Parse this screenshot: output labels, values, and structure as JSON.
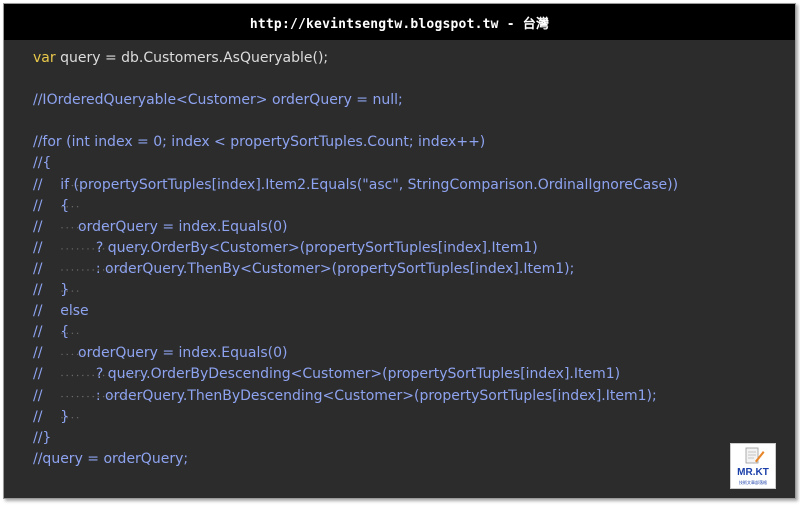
{
  "header": {
    "title": "http://kevintsengtw.blogspot.tw - 台灣"
  },
  "code": {
    "lines": [
      {
        "kw": "var",
        "rest": " query = db.Customers.AsQueryable();"
      },
      {
        "kw": "",
        "rest": ""
      },
      {
        "comment": "//IOrderedQueryable<Customer> orderQuery = null;"
      },
      {
        "kw": "",
        "rest": ""
      },
      {
        "comment": "//for (int index = 0; index < propertySortTuples.Count; index++)"
      },
      {
        "comment": "//{"
      },
      {
        "comment": "//    if (propertySortTuples[index].Item2.Equals(\"asc\", StringComparison.OrdinalIgnoreCase))"
      },
      {
        "comment": "//    {"
      },
      {
        "comment": "//        orderQuery = index.Equals(0)"
      },
      {
        "comment": "//            ? query.OrderBy<Customer>(propertySortTuples[index].Item1)"
      },
      {
        "comment": "//            : orderQuery.ThenBy<Customer>(propertySortTuples[index].Item1);"
      },
      {
        "comment": "//    }"
      },
      {
        "comment": "//    else"
      },
      {
        "comment": "//    {"
      },
      {
        "comment": "//        orderQuery = index.Equals(0)"
      },
      {
        "comment": "//            ? query.OrderByDescending<Customer>(propertySortTuples[index].Item1)"
      },
      {
        "comment": "//            : orderQuery.ThenByDescending<Customer>(propertySortTuples[index].Item1);"
      },
      {
        "comment": "//    }"
      },
      {
        "comment": "//}"
      },
      {
        "comment": "//query = orderQuery;"
      }
    ]
  },
  "logo": {
    "text": "MR.KT",
    "subtext": "技術文章部落格"
  },
  "colors": {
    "background": "#2c2c2c",
    "header": "#000000",
    "keyword": "#e9c84a",
    "comment": "#8ea3f0",
    "plain": "#dcdcdc"
  }
}
